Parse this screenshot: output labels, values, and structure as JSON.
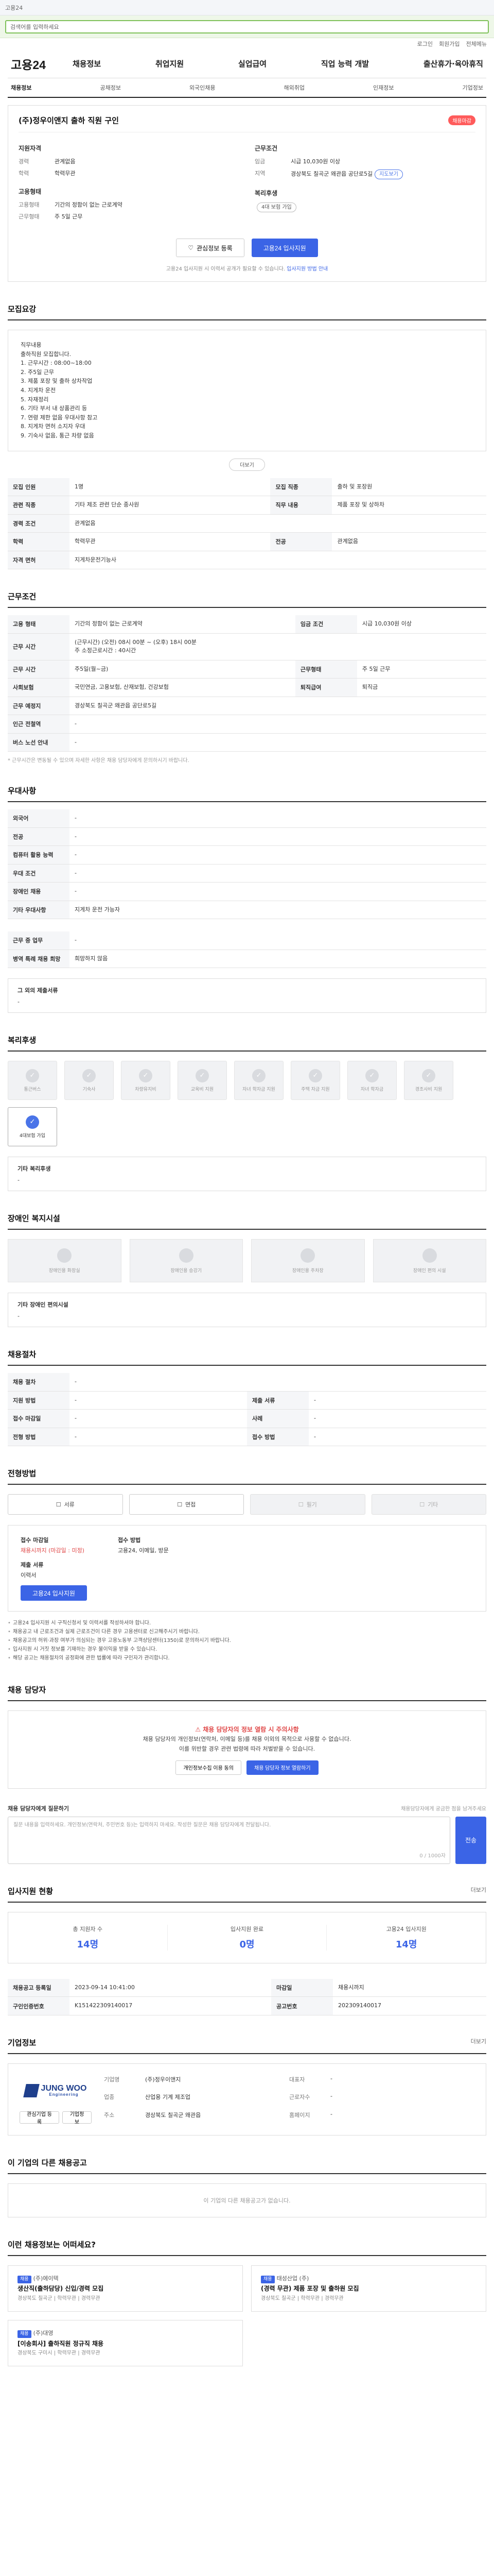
{
  "topbar": {
    "site": "고용24",
    "links": [
      "로그인",
      "회원가입"
    ]
  },
  "search": {
    "placeholder": "검색어를 입력하세요"
  },
  "utils": [
    "로그인",
    "회원가입",
    "전체메뉴"
  ],
  "logo": "고용24",
  "gnb": [
    "채용정보",
    "취업지원",
    "실업급여",
    "직업 능력 개발",
    "출산휴가·육아휴직"
  ],
  "subnav": [
    "채용정보",
    "공채정보",
    "외국인채용",
    "해외취업",
    "인재정보",
    "기업정보"
  ],
  "job": {
    "title": "(주)정우이앤지 출하 직원 구인",
    "badge": "채용마감",
    "recruit_heading": "지원자격",
    "career_k": "경력",
    "career_v": "관계없음",
    "edu_k": "학력",
    "edu_v": "학력무관",
    "emp_heading": "고용형태",
    "emptype_k": "고용형태",
    "emptype_v": "기간의 정함이 없는 근로계약",
    "worktype_k": "근무형태",
    "worktype_v": "주 5일 근무",
    "cond_heading": "근무조건",
    "wage_k": "임금",
    "wage_v": "시급 10,030원 이상",
    "loc_k": "지역",
    "loc_v": "경상북도 칠곡군 왜관읍 공단로5길",
    "loc_pill": "지도보기",
    "welfare_heading": "복리후생",
    "welfare_v": "4대 보험 가입"
  },
  "actions": {
    "scrap": "관심정보 등록",
    "apply": "고용24 입사지원"
  },
  "apply_note_1": "고용24 입사지원 시 이력서 공개가 필요할 수 있습니다.",
  "apply_note_2": "입사지원 방법 안내",
  "sections": {
    "recruit": "모집요강",
    "work": "근무조건",
    "extra": "우대사항",
    "welfare": "복리후생",
    "disabled": "장애인 복지시설",
    "hire": "채용절차",
    "method": "전형방법",
    "contact": "채용 담당자",
    "stats": "입사지원 현황",
    "company": "기업정보",
    "hist": "이 기업의 다른 채용공고",
    "recommend": "이런 채용정보는 어떠세요?"
  },
  "jobdesc": "직무내용\n출하직원 모집합니다.\n1. 근무시간 : 08:00~18:00\n2. 주5일 근무\n3. 제품 포장 및 출하 상차작업\n4. 지게차 운전\n5. 자재정리\n6. 기타 부서 내 상품관리 등\n7. 연령 제한 없음 우대사항 참고\n8. 지게차 면허 소지자 우대\n9. 기숙사 없음, 통근 차량 없음",
  "more_btn": "더보기",
  "recruit_table": [
    {
      "k": "모집 인원",
      "v": "1명",
      "k2": "모집 직종",
      "v2": "출하 및 포장원"
    },
    {
      "k": "관련 직종",
      "v": "기타 제조 관련 단순 종사원",
      "k2": "직무 내용",
      "v2": "제품 포장 및 상하차"
    },
    {
      "k": "경력 조건",
      "v": "관계없음",
      "k2": "",
      "v2": ""
    },
    {
      "k": "학력",
      "v": "학력무관",
      "k2": "전공",
      "v2": "관계없음"
    },
    {
      "k": "자격 면허",
      "v": "지게차운전기능사",
      "k2": "",
      "v2": ""
    }
  ],
  "work_table": [
    {
      "k": "고용 형태",
      "v": "기간의 정함이 없는 근로계약",
      "k2": "임금 조건",
      "v2": "시급 10,030원 이상"
    },
    {
      "k": "근무 시간",
      "v": "(근무시간) (오전) 08시 00분 ~ (오후) 18시 00분\n주 소정근로시간 : 40시간",
      "k2": "",
      "v2": ""
    },
    {
      "k": "근무 시간",
      "v": "주5일(월~금)",
      "k2": "근무형태",
      "v2": "주 5일 근무"
    },
    {
      "k": "사회보험",
      "v": "국민연금, 고용보험, 산재보험, 건강보험",
      "k2": "퇴직급여",
      "v2": "퇴직금"
    },
    {
      "k": "근무 예정지",
      "v": "경상북도 칠곡군 왜관읍 공단로5길",
      "k2": "",
      "v2": ""
    },
    {
      "k": "인근 전철역",
      "v": "-",
      "k2": "",
      "v2": ""
    },
    {
      "k": "버스 노선 안내",
      "v": "-",
      "k2": "",
      "v2": ""
    }
  ],
  "work_note": "* 근무시간은 변동될 수 있으며 자세한 사항은 채용 담당자에게 문의하시기 바랍니다.",
  "map_btn": "지도 보기",
  "extra_table": [
    {
      "k": "외국어",
      "v": "-"
    },
    {
      "k": "전공",
      "v": "-"
    },
    {
      "k": "컴퓨터 활용 능력",
      "v": "-"
    },
    {
      "k": "우대 조건",
      "v": "-"
    },
    {
      "k": "장애인 채용",
      "v": "-"
    },
    {
      "k": "기타 우대사항",
      "v": "지게차 운전 가능자"
    }
  ],
  "extra2_table": [
    {
      "k": "근무 중 업무",
      "v": "-"
    },
    {
      "k": "병역 특례 채용 희망",
      "v": "희망하지 않음"
    }
  ],
  "etc_title": "그 외의 제출서류",
  "etc_value": "-",
  "welfare_cards": [
    {
      "label": "통근버스",
      "on": false
    },
    {
      "label": "기숙사",
      "on": false
    },
    {
      "label": "차량유지비",
      "on": false
    },
    {
      "label": "교육비 지원",
      "on": false
    },
    {
      "label": "자녀 학자금 지원",
      "on": false
    },
    {
      "label": "주택 자금 지원",
      "on": false
    },
    {
      "label": "자녀 학자금",
      "on": false
    },
    {
      "label": "경조사비 지원",
      "on": false
    },
    {
      "label": "4대보험 가입",
      "on": true
    }
  ],
  "welfare_other_title": "기타 복리후생",
  "welfare_other_v": "-",
  "disabled_cards": [
    "장애인용 화장실",
    "장애인용 승강기",
    "장애인용 주차장",
    "장애인 편의 시설"
  ],
  "disabled_other_title": "기타 장애인 편의시설",
  "disabled_other_v": "-",
  "hire_table": [
    {
      "k": "채용 절차",
      "v": "-",
      "k2": "",
      "v2": ""
    },
    {
      "k": "지원 방법",
      "v": "-",
      "k2": "제출 서류",
      "v2": "-"
    },
    {
      "k": "접수 마감일",
      "v": "-",
      "k2": "사례",
      "v2": "-"
    },
    {
      "k": "전형 방법",
      "v": "-",
      "k2": "접수 방법",
      "v2": "-"
    }
  ],
  "methods": [
    {
      "label": "서류",
      "on": true
    },
    {
      "label": "면접",
      "on": true
    },
    {
      "label": "필기",
      "on": false
    },
    {
      "label": "기타",
      "on": false
    }
  ],
  "apply_box": {
    "deadline_k": "접수 마감일",
    "deadline_v": "채용시까지 (마감일 : 미정)",
    "method_k": "접수 방법",
    "method_v": "고용24, 이메일, 방문",
    "doc_k": "제출 서류",
    "doc_v": "이력서",
    "apply_btn": "고용24 입사지원"
  },
  "bullets": [
    "고용24 입사지원 시 구직신청서 및 이력서를 작성하셔야 합니다.",
    "채용공고 내 근로조건과 실제 근로조건이 다른 경우 고용센터로 신고해주시기 바랍니다.",
    "채용공고의 허위·과장 여부가 의심되는 경우 고용노동부 고객상담센터(1350)로 문의하시기 바랍니다.",
    "입사지원 시 거짓 정보를 기재하는 경우 불이익을 받을 수 있습니다.",
    "해당 공고는 채용절차의 공정화에 관한 법률에 따라 구인자가 관리합니다."
  ],
  "contact": {
    "warn": "채용 담당자의 정보 열람 시 주의사항",
    "line1": "채용 담당자의 개인정보(연락처, 이메일 등)를 채용 이외의 목적으로 사용할 수 없습니다.",
    "line2": "이를 위반할 경우 관련 법령에 따라 처벌받을 수 있습니다.",
    "btn1": "개인정보수집 이용 동의",
    "btn2": "채용 담당자 정보 열람하기"
  },
  "question": {
    "title": "채용 담당자에게 질문하기",
    "hint": "채용담당자에게 궁금한 점을 남겨주세요",
    "placeholder": "질문 내용을 입력하세요. 개인정보(연락처, 주민번호 등)는 입력하지 마세요. 작성한 질문은 채용 담당자에게 전달됩니다.",
    "count": "0 / 1000자",
    "send": "전송"
  },
  "stats_more": "더보기",
  "stats": [
    {
      "label": "총 지원자 수",
      "value": "14명"
    },
    {
      "label": "입사지원 완료",
      "value": "0명"
    },
    {
      "label": "고용24 입사지원",
      "value": "14명"
    }
  ],
  "info_table": [
    {
      "k": "채용공고 등록일",
      "v": "2023-09-14 10:41:00",
      "k2": "마감일",
      "v2": "채용시까지"
    },
    {
      "k": "구인인증번호",
      "v": "K151422309140017",
      "k2": "공고번호",
      "v2": "202309140017"
    }
  ],
  "company": {
    "more": "더보기",
    "logo_name": "JUNG WOO",
    "logo_sub": "Engineering",
    "btn1": "관심기업 등록",
    "btn2": "기업정보",
    "name_k": "기업명",
    "name_v": "(주)정우이앤지",
    "ceo_k": "대표자",
    "ceo_v": "-",
    "ind_k": "업종",
    "ind_v": "산업용 기계 제조업",
    "emp_k": "근로자수",
    "emp_v": "-",
    "addr_k": "주소",
    "addr_v": "경상북도 칠곡군 왜관읍",
    "home_k": "홈페이지",
    "home_v": "-"
  },
  "hist_empty": "이 기업의 다른 채용공고가 없습니다.",
  "recommend": [
    {
      "tag": "채용",
      "co": "(주)에이텍",
      "title": "생산직(출하담당) 신입/경력 모집",
      "meta": "경상북도 칠곡군 | 학력무관 | 경력무관"
    },
    {
      "tag": "채용",
      "co": "태성산업 (주)",
      "title": "(경력 무관) 제품 포장 및 출하원 모집",
      "meta": "경상북도 칠곡군 | 학력무관 | 경력무관"
    },
    {
      "tag": "채용",
      "co": "(주)대영",
      "title": "[이송회사] 출하직원 정규직 채용",
      "meta": "경상북도 구미시 | 학력무관 | 경력무관"
    }
  ]
}
